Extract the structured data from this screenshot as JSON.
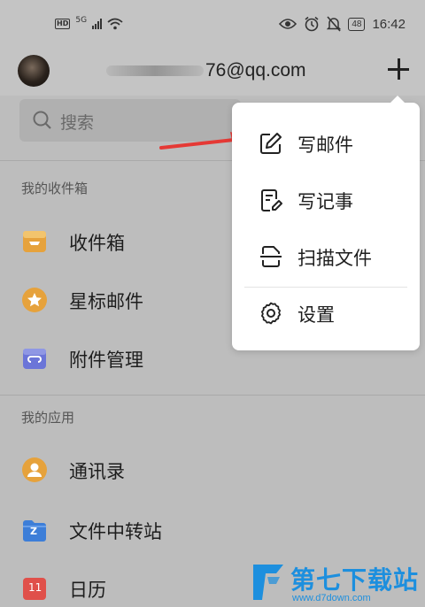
{
  "status_bar": {
    "hd": "HD",
    "network": "5G",
    "battery": "48",
    "time": "16:42",
    "icons": [
      "eye-icon",
      "alarm-icon",
      "mute-icon",
      "battery-icon"
    ]
  },
  "header": {
    "email_suffix": "76@qq.com",
    "add_icon": "plus-icon"
  },
  "search": {
    "placeholder": "搜索"
  },
  "sections": {
    "inbox_title": "我的收件箱",
    "apps_title": "我的应用"
  },
  "inbox_items": [
    {
      "label": "收件箱",
      "icon": "inbox-tray-icon",
      "color": "#e6a23c"
    },
    {
      "label": "星标邮件",
      "icon": "star-icon",
      "color": "#e6a23c"
    },
    {
      "label": "附件管理",
      "icon": "attachment-icon",
      "color": "#6b75d8"
    }
  ],
  "app_items": [
    {
      "label": "通讯录",
      "icon": "contacts-icon",
      "color": "#e6a23c"
    },
    {
      "label": "文件中转站",
      "icon": "folder-z-icon",
      "color": "#3d7ed8",
      "badge": "Z"
    },
    {
      "label": "日历",
      "icon": "calendar-icon",
      "color": "#e0504a",
      "badge": "11"
    }
  ],
  "menu": {
    "items": [
      {
        "label": "写邮件",
        "icon": "compose-icon"
      },
      {
        "label": "写记事",
        "icon": "note-icon"
      },
      {
        "label": "扫描文件",
        "icon": "scan-icon"
      },
      {
        "label": "设置",
        "icon": "gear-icon"
      }
    ]
  },
  "watermark": {
    "text": "第七下载站",
    "url": "www.d7down.com",
    "color": "#1d8fde"
  },
  "colors": {
    "overlay_bg": "#bdbdbd",
    "arrow": "#e53935"
  }
}
